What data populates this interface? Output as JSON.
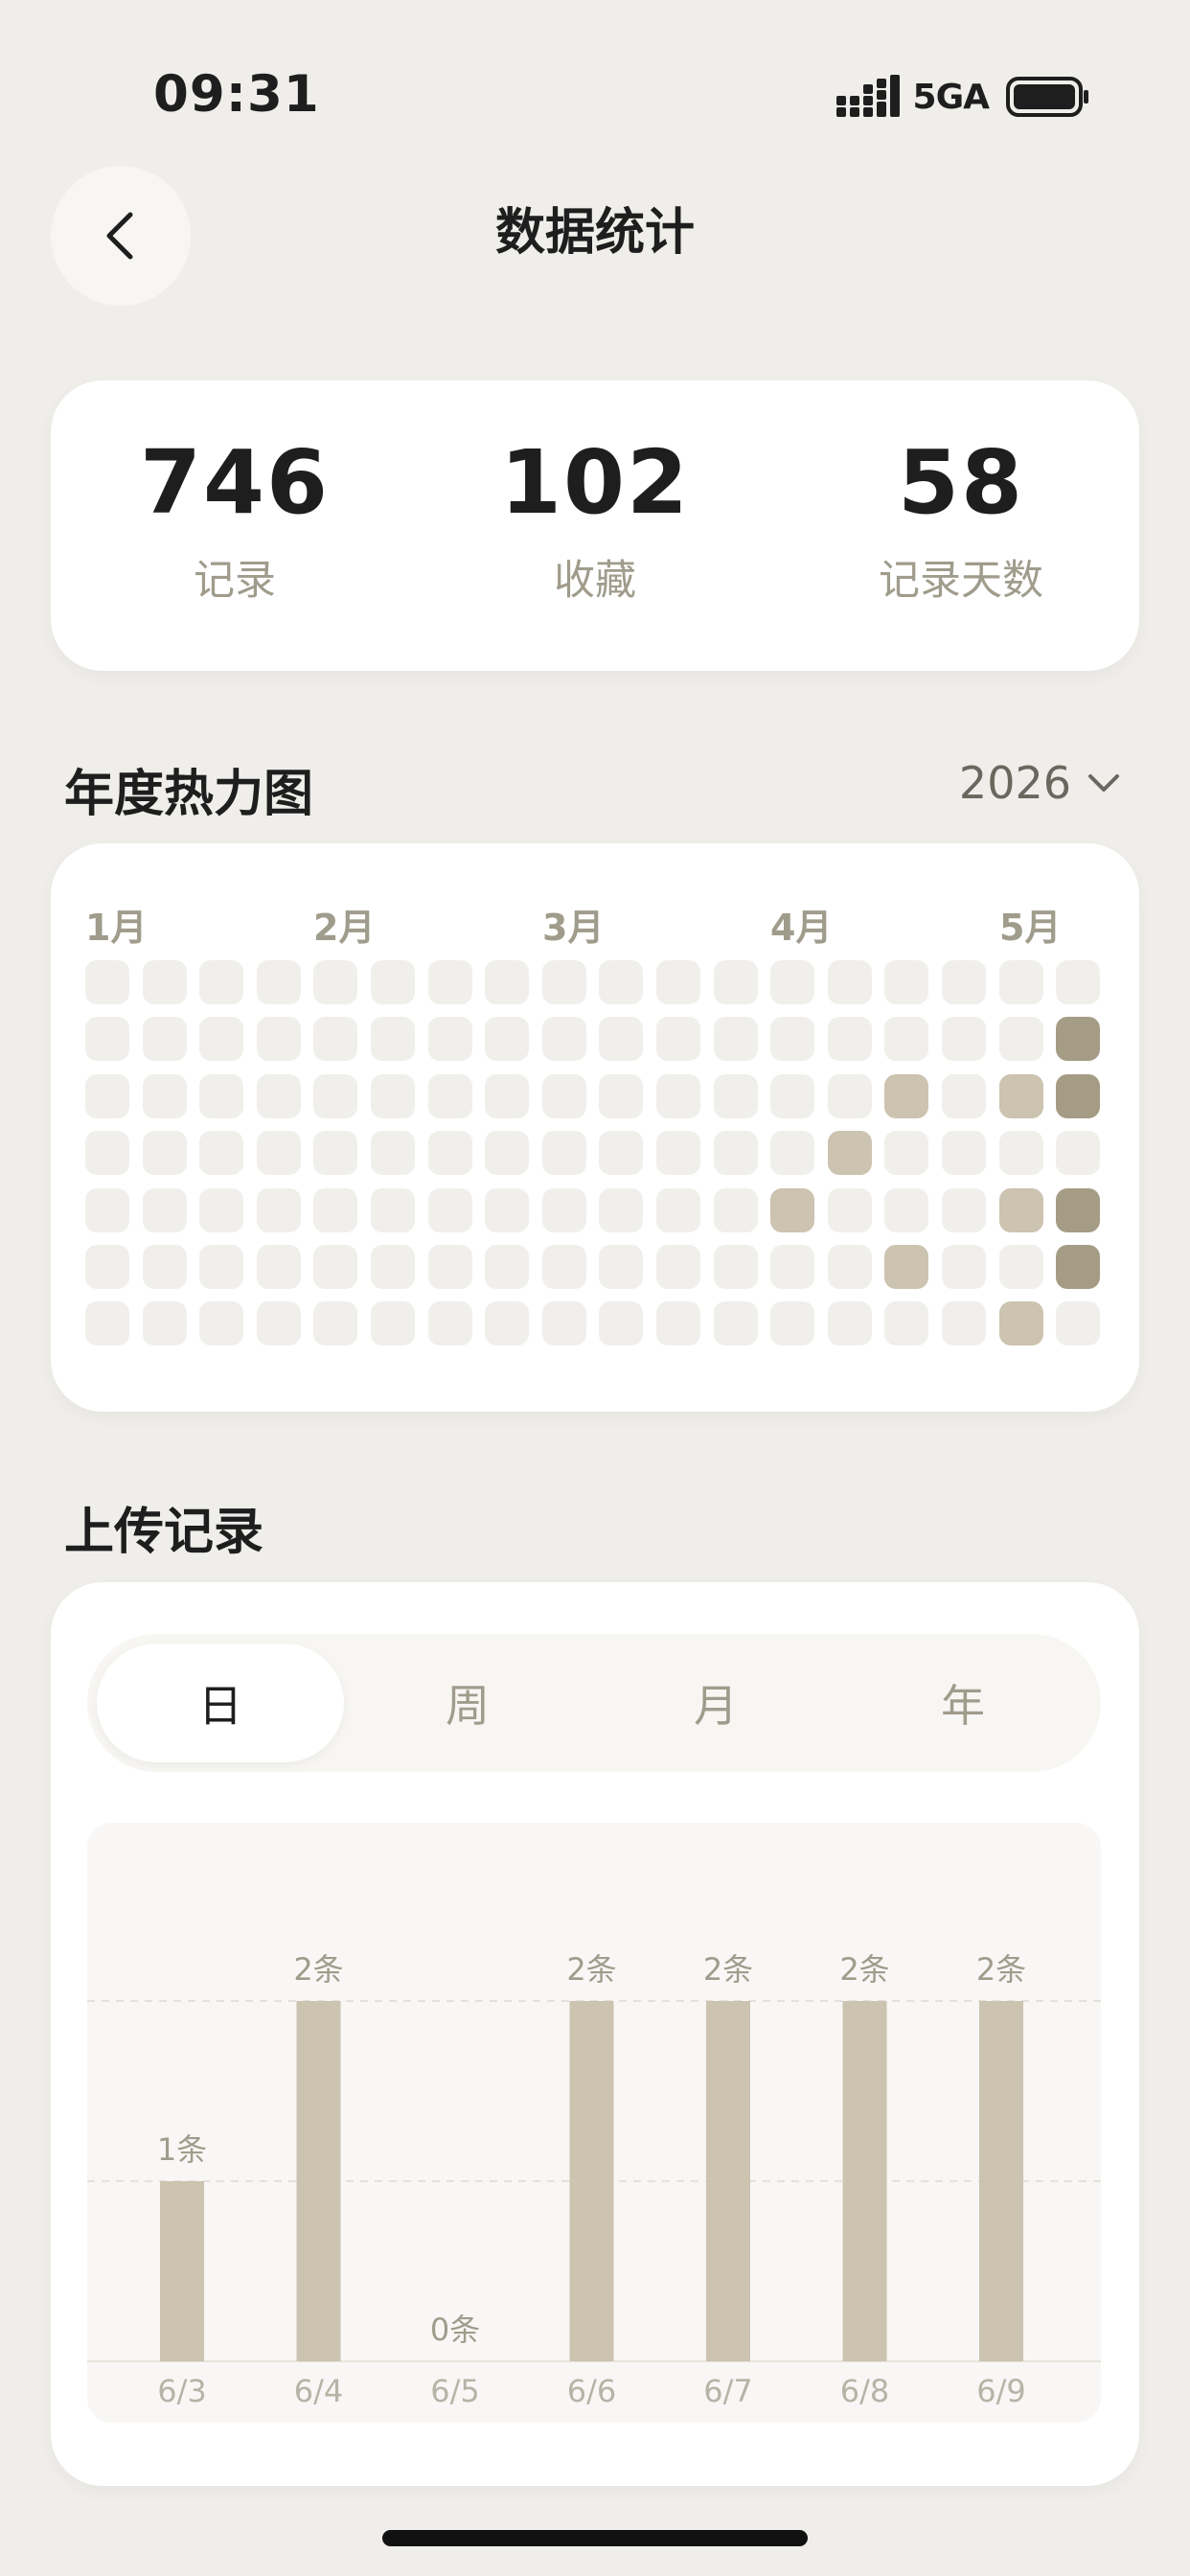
{
  "status_bar": {
    "time": "09:31",
    "network": "5GA",
    "icons": [
      "signal-icon",
      "battery-icon"
    ]
  },
  "header": {
    "title": "数据统计",
    "back_icon": "chevron-left-icon"
  },
  "summary": [
    {
      "value": "746",
      "label": "记录"
    },
    {
      "value": "102",
      "label": "收藏"
    },
    {
      "value": "58",
      "label": "记录天数"
    }
  ],
  "heatmap": {
    "title": "年度热力图",
    "year": "2026",
    "dropdown_icon": "chevron-down-icon",
    "months": [
      "1月",
      "2月",
      "3月",
      "4月",
      "5月"
    ],
    "columns": 18,
    "rows": 7,
    "active_cells": [
      {
        "col": 17,
        "row": 1,
        "level": 2
      },
      {
        "col": 14,
        "row": 2,
        "level": 1
      },
      {
        "col": 16,
        "row": 2,
        "level": 1
      },
      {
        "col": 17,
        "row": 2,
        "level": 2
      },
      {
        "col": 13,
        "row": 3,
        "level": 1
      },
      {
        "col": 12,
        "row": 4,
        "level": 1
      },
      {
        "col": 16,
        "row": 4,
        "level": 1
      },
      {
        "col": 17,
        "row": 4,
        "level": 2
      },
      {
        "col": 14,
        "row": 5,
        "level": 1
      },
      {
        "col": 17,
        "row": 5,
        "level": 2
      },
      {
        "col": 16,
        "row": 6,
        "level": 1
      }
    ],
    "colors": {
      "empty": "#F0EFEB",
      "level_1": "#CCC3B0",
      "level_2": "#A59C85"
    }
  },
  "upload": {
    "title": "上传记录",
    "tabs": [
      {
        "label": "日",
        "active": true
      },
      {
        "label": "周",
        "active": false
      },
      {
        "label": "月",
        "active": false
      },
      {
        "label": "年",
        "active": false
      }
    ]
  },
  "chart_data": {
    "type": "bar",
    "categories": [
      "6/3",
      "6/4",
      "6/5",
      "6/6",
      "6/7",
      "6/8",
      "6/9"
    ],
    "values": [
      1,
      2,
      0,
      2,
      2,
      2,
      2
    ],
    "data_labels": [
      "1条",
      "2条",
      "0条",
      "2条",
      "2条",
      "2条",
      "2条"
    ],
    "ylim": [
      0,
      2
    ],
    "grid": true,
    "bar_color": "#CCC3B0"
  }
}
